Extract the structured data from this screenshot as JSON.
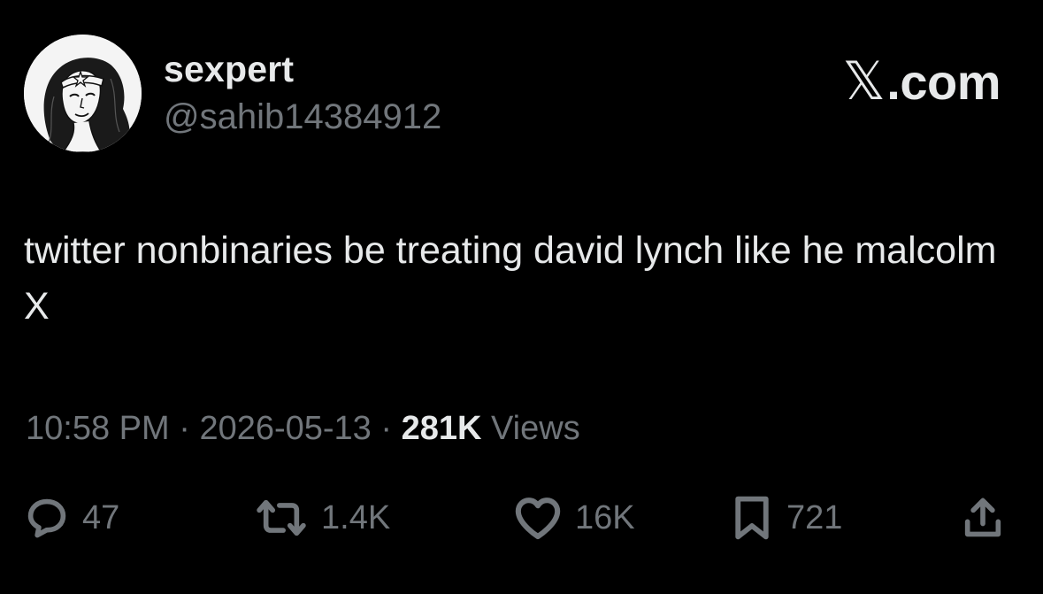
{
  "author": {
    "display_name": "sexpert",
    "handle": "@sahib14384912",
    "avatar_icon": "avatar-illustration-icon"
  },
  "watermark": {
    "x_glyph": "𝕏",
    "text": ".com"
  },
  "tweet": {
    "text": "twitter nonbinaries be treating david lynch like he malcolm X"
  },
  "meta": {
    "time": "10:58 PM",
    "separator": " · ",
    "date": "2026-05-13",
    "views_count": "281K",
    "views_label": " Views"
  },
  "actions": {
    "reply": {
      "icon": "reply-icon",
      "count": "47"
    },
    "retweet": {
      "icon": "retweet-icon",
      "count": "1.4K"
    },
    "like": {
      "icon": "heart-icon",
      "count": "16K"
    },
    "bookmark": {
      "icon": "bookmark-icon",
      "count": "721"
    },
    "share": {
      "icon": "share-icon"
    }
  },
  "colors": {
    "background": "#000000",
    "primary_text": "#e7e9ea",
    "secondary_text": "#71767b"
  }
}
